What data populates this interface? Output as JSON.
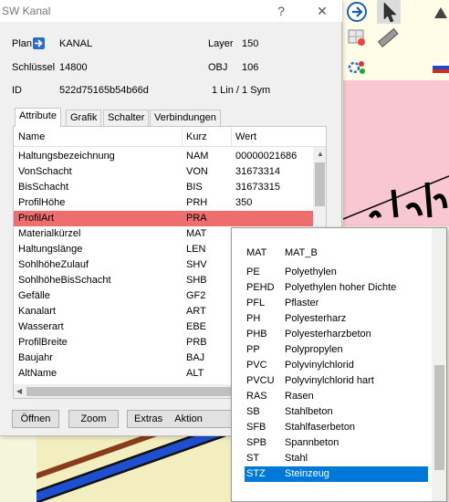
{
  "window": {
    "title": "SW Kanal",
    "help_glyph": "?",
    "close_glyph": "✕"
  },
  "header": {
    "plan_label": "Plan",
    "plan_value": "KANAL",
    "layer_label": "Layer",
    "layer_value": "150",
    "schluessel_label": "Schlüssel",
    "schluessel_value": "14800",
    "obj_label": "OBJ",
    "obj_value": "106",
    "id_label": "ID",
    "id_value": "522d75165b54b66d",
    "lin_sym": "1 Lin / 1 Sym"
  },
  "tabs": [
    {
      "label": "Attribute",
      "active": true
    },
    {
      "label": "Grafik",
      "active": false
    },
    {
      "label": "Schalter",
      "active": false
    },
    {
      "label": "Verbindungen",
      "active": false
    }
  ],
  "grid": {
    "columns": [
      "Name",
      "Kurz",
      "Wert"
    ],
    "rows": [
      {
        "name": "Haltungsbezeichnung",
        "kurz": "NAM",
        "wert": "00000021686"
      },
      {
        "name": "VonSchacht",
        "kurz": "VON",
        "wert": "31673314"
      },
      {
        "name": "BisSchacht",
        "kurz": "BIS",
        "wert": "31673315"
      },
      {
        "name": "ProfilHöhe",
        "kurz": "PRH",
        "wert": "350"
      },
      {
        "name": "ProfilArt",
        "kurz": "PRA",
        "wert": ""
      },
      {
        "name": "Materialkürzel",
        "kurz": "MAT",
        "wert": ""
      },
      {
        "name": "Haltungslänge",
        "kurz": "LEN",
        "wert": ""
      },
      {
        "name": "SohlhöheZulauf",
        "kurz": "SHV",
        "wert": ""
      },
      {
        "name": "SohlhöheBisSchacht",
        "kurz": "SHB",
        "wert": ""
      },
      {
        "name": "Gefälle",
        "kurz": "GF2",
        "wert": ""
      },
      {
        "name": "Kanalart",
        "kurz": "ART",
        "wert": ""
      },
      {
        "name": "Wasserart",
        "kurz": "EBE",
        "wert": ""
      },
      {
        "name": "ProfilBreite",
        "kurz": "PRB",
        "wert": ""
      },
      {
        "name": "Baujahr",
        "kurz": "BAJ",
        "wert": ""
      },
      {
        "name": "AltName",
        "kurz": "ALT",
        "wert": ""
      }
    ],
    "highlight_color": "#ee6e70"
  },
  "buttons": {
    "oeffnen": "Öffnen",
    "zoom": "Zoom",
    "extras": "Extras",
    "aktion": "Aktion"
  },
  "dropdown": {
    "columns": [
      "MAT",
      "MAT_B"
    ],
    "items": [
      {
        "code": "PE",
        "desc": "Polyethylen",
        "selected": false
      },
      {
        "code": "PEHD",
        "desc": "Polyethylen hoher Dichte",
        "selected": false
      },
      {
        "code": "PFL",
        "desc": "Pflaster",
        "selected": false
      },
      {
        "code": "PH",
        "desc": "Polyesterharz",
        "selected": false
      },
      {
        "code": "PHB",
        "desc": "Polyesterharzbeton",
        "selected": false
      },
      {
        "code": "PP",
        "desc": "Polypropylen",
        "selected": false
      },
      {
        "code": "PVC",
        "desc": "Polyvinylchlorid",
        "selected": false
      },
      {
        "code": "PVCU",
        "desc": "Polyvinylchlorid hart",
        "selected": false
      },
      {
        "code": "RAS",
        "desc": "Rasen",
        "selected": false
      },
      {
        "code": "SB",
        "desc": "Stahlbeton",
        "selected": false
      },
      {
        "code": "SFB",
        "desc": "Stahlfaserbeton",
        "selected": false
      },
      {
        "code": "SPB",
        "desc": "Spannbeton",
        "selected": false
      },
      {
        "code": "ST",
        "desc": "Stahl",
        "selected": false
      },
      {
        "code": "STZ",
        "desc": "Steinzeug",
        "selected": true
      }
    ],
    "selected_color": "#0078d7"
  },
  "toolbar": {
    "icons": [
      "nav-arrow-icon",
      "pointer-icon",
      "layer-image-icon",
      "ruler-icon",
      "settings-icon",
      "flag-icon"
    ]
  },
  "map": {
    "pink_color": "#f9c7d2",
    "canvas_color": "#f5f5dc"
  }
}
